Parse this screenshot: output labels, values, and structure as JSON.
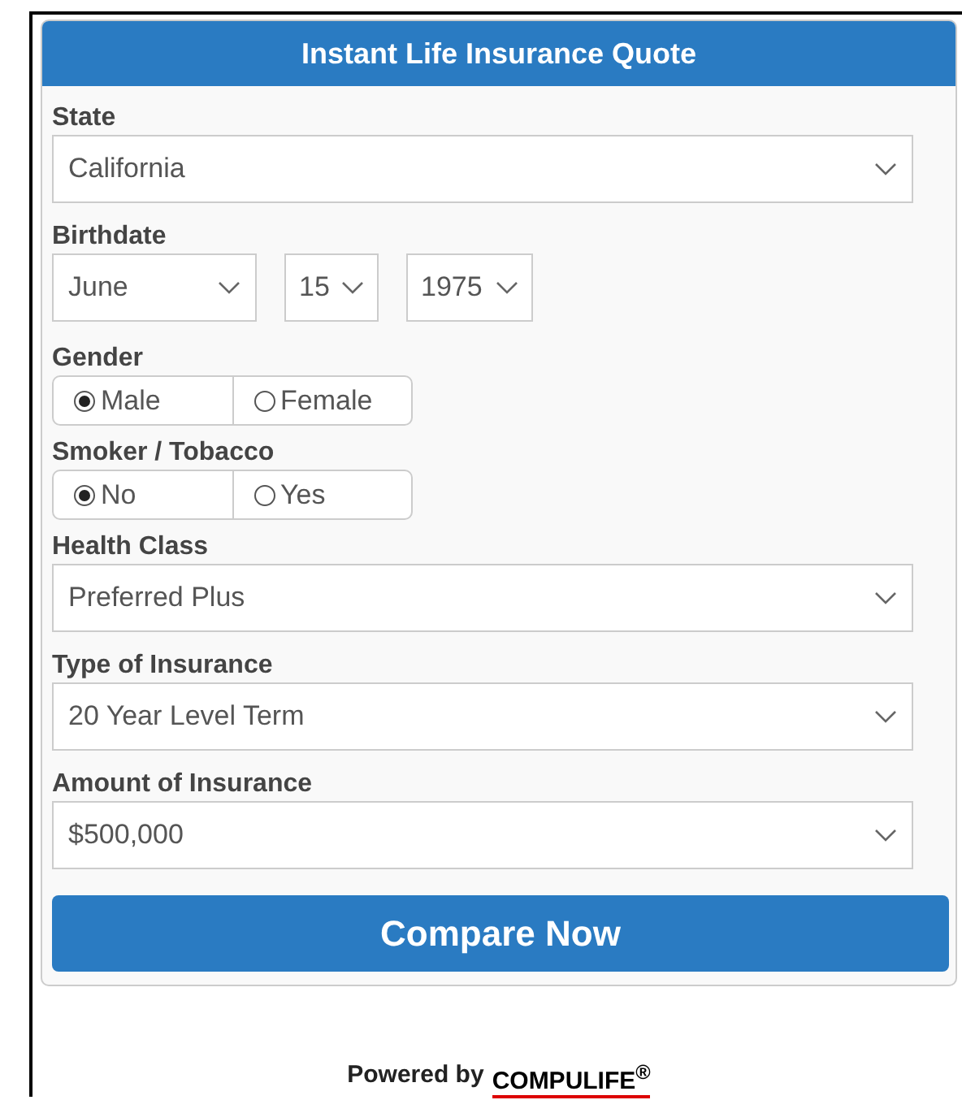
{
  "title": "Instant Life Insurance Quote",
  "fields": [
    {
      "kind": "select",
      "label": "State",
      "value": "California"
    },
    {
      "kind": "date",
      "label": "Birthdate",
      "parts": [
        "June",
        "15",
        "1975"
      ]
    },
    {
      "kind": "radio",
      "label": "Gender",
      "options": [
        {
          "label": "Male",
          "selected": true
        },
        {
          "label": "Female",
          "selected": false
        }
      ]
    },
    {
      "kind": "radio",
      "label": "Smoker / Tobacco",
      "options": [
        {
          "label": "No",
          "selected": true
        },
        {
          "label": "Yes",
          "selected": false
        }
      ]
    },
    {
      "kind": "select",
      "label": "Health Class",
      "value": "Preferred Plus"
    },
    {
      "kind": "select",
      "label": "Type of Insurance",
      "value": "20 Year Level Term"
    },
    {
      "kind": "select",
      "label": "Amount of Insurance",
      "value": "$500,000"
    }
  ],
  "button": "Compare Now",
  "footer": {
    "text": "Powered by",
    "brand": "COMPULIFE$^{®}$"
  }
}
